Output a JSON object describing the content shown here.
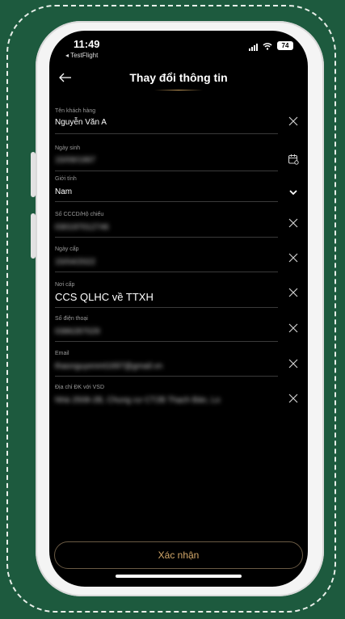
{
  "status_bar": {
    "time": "11:49",
    "back_app": "◂ TestFlight",
    "battery": "74"
  },
  "header": {
    "title": "Thay đổi thông tin"
  },
  "fields": [
    {
      "label": "Tên khách hàng",
      "value": "Nguyễn Văn A",
      "blurred": false,
      "action": "clear"
    },
    {
      "label": "Ngày sinh",
      "value": "15/09/1997",
      "blurred": true,
      "action": "calendar"
    },
    {
      "label": "Giới tính",
      "value": "Nam",
      "blurred": false,
      "action": "dropdown"
    },
    {
      "label": "Số CCCD/Hộ chiếu",
      "value": "030197012746",
      "blurred": true,
      "action": "clear"
    },
    {
      "label": "Ngày cấp",
      "value": "15/04/2022",
      "blurred": true,
      "action": "clear"
    },
    {
      "label": "Nơi cấp",
      "value": "CCS QLHC về TTXH",
      "blurred": false,
      "action": "clear"
    },
    {
      "label": "Số điện thoại",
      "value": "0386287029",
      "blurred": true,
      "action": "clear"
    },
    {
      "label": "Email",
      "value": "thaonguyenmt1697@gmail.vn",
      "blurred": true,
      "action": "clear"
    },
    {
      "label": "Địa chỉ ĐK với VSD",
      "value": "Nhà 2508-2B, Chung cư CT2B Thạch Bàn, Lo",
      "blurred": true,
      "action": "clear"
    }
  ],
  "confirm": {
    "label": "Xác nhận"
  },
  "colors": {
    "background": "#1d5a3e",
    "accent": "#d4a96a",
    "screen": "#000000"
  }
}
